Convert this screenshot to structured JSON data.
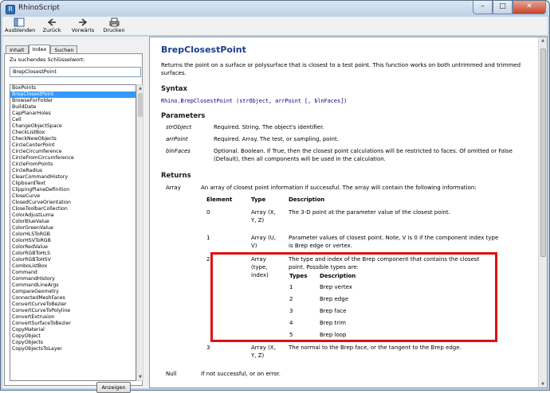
{
  "window": {
    "title": "RhinoScript",
    "minimize": "–",
    "maximize": "□",
    "close": "✕"
  },
  "toolbar": {
    "items": [
      {
        "label": "Ausblenden",
        "icon": "hide-icon"
      },
      {
        "label": "Zurück",
        "icon": "back-arrow-icon"
      },
      {
        "label": "Vorwärts",
        "icon": "forward-arrow-icon"
      },
      {
        "label": "Drucken",
        "icon": "printer-icon"
      }
    ]
  },
  "nav": {
    "tabs": [
      "Inhalt",
      "Index",
      "Suchen"
    ],
    "active_tab": "Index",
    "search_label": "Zu suchendes Schlüsselwort:",
    "search_value": "BrepClosestPoint",
    "show_button": "Anzeigen",
    "list": [
      "BoxPoints",
      "BrepClosestPoint",
      "BrowseForFolder",
      "BuildDate",
      "CapPlanarHoles",
      "Cell",
      "ChangeObjectSpace",
      "CheckListBox",
      "CheckNewObjects",
      "CircleCenterPoint",
      "CircleCircumference",
      "CircleFromCircumference",
      "CircleFromPoints",
      "CircleRadius",
      "ClearCommandHistory",
      "ClipboardText",
      "ClippingPlaneDefinition",
      "CloseCurve",
      "ClosedCurveOrientation",
      "CloseToolbarCollection",
      "ColorAdjustLuma",
      "ColorBlueValue",
      "ColorGreenValue",
      "ColorHLSToRGB",
      "ColorHSVToRGB",
      "ColorRedValue",
      "ColorRGBToHLS",
      "ColorRGBToHSV",
      "ComboListBox",
      "Command",
      "CommandHistory",
      "CommandLineArgs",
      "CompareGeometry",
      "ConnectedMeshFaces",
      "ConvertCurveToBezier",
      "ConvertCurveToPolyline",
      "ConvertExtrusion",
      "ConvertSurfaceToBezier",
      "CopyMaterial",
      "CopyObject",
      "CopyObjects",
      "CopyObjectsToLayer"
    ],
    "selected_index": 1
  },
  "doc": {
    "title": "BrepClosestPoint",
    "description": "Returns the point on a surface or polysurface that is closest to a test point. This function works on both untrimmed and trimmed surfaces.",
    "syntax_heading": "Syntax",
    "syntax": "Rhino.BrepClosestPoint (strObject, arrPoint [, blnFaces])",
    "parameters_heading": "Parameters",
    "parameters": [
      {
        "name": "strObject",
        "desc": "Required. String. The object's identifier."
      },
      {
        "name": "arrPoint",
        "desc": "Required. Array. The test, or sampling, point."
      },
      {
        "name": "blnFaces",
        "desc": "Optional. Boolean. If True, then the closest point calculations will be restricted to faces. Of omitted or False (Default), then all components will be used in the calculation."
      }
    ],
    "returns_heading": "Returns",
    "returns_array_label": "Array",
    "returns_array_desc": "An array of closest point information if successful. The array will contain the following information:",
    "table_headers": [
      "Element",
      "Type",
      "Description"
    ],
    "rows": [
      {
        "element": "0",
        "type": "Array (X, Y, Z)",
        "desc": "The 3-D point at the parameter value of the closest point."
      },
      {
        "element": "1",
        "type": "Array (U, V)",
        "desc": "Parameter values of closest point. Note, V is 0 if the component index type is Brep edge or vertex."
      },
      {
        "element": "2",
        "type": "Array (type, index)",
        "desc": "The type and index of the Brep component that contains the closest point. Possible types are:"
      },
      {
        "element": "3",
        "type": "Array (X, Y, Z)",
        "desc": "The normal to the Brep face, or the tangent to the Brep edge."
      }
    ],
    "types_headers": [
      "Types",
      "Description"
    ],
    "types": [
      {
        "n": "1",
        "d": "Brep vertex"
      },
      {
        "n": "2",
        "d": "Brep edge"
      },
      {
        "n": "3",
        "d": "Brep face"
      },
      {
        "n": "4",
        "d": "Brep trim"
      },
      {
        "n": "5",
        "d": "Brep loop"
      }
    ],
    "returns_null_label": "Null",
    "returns_null_desc": "If not successful, or on error."
  },
  "colors": {
    "title_blue": "#1b3b8e",
    "highlight_red": "#e01010",
    "selection": "#3399ff"
  }
}
